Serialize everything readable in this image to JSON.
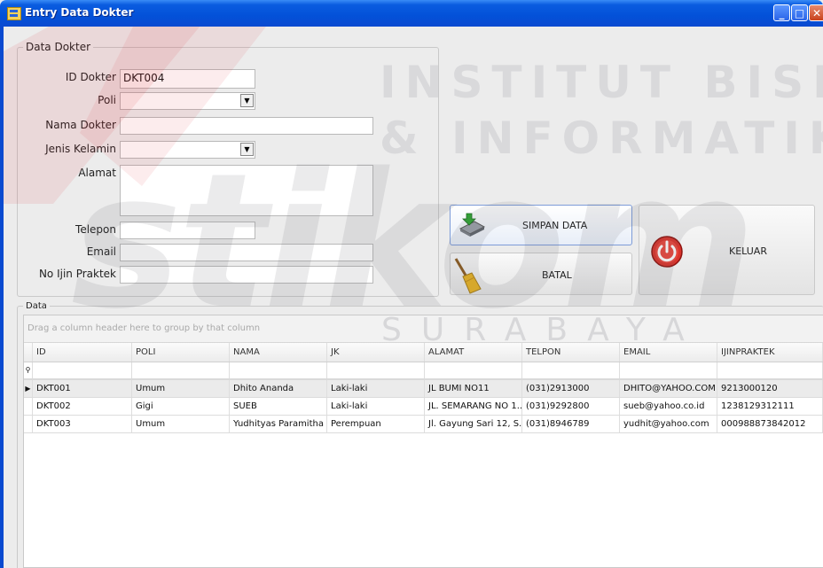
{
  "window": {
    "title": "Entry Data Dokter"
  },
  "form": {
    "group_title": "Data Dokter",
    "fields": {
      "id_dokter": {
        "label": "ID Dokter",
        "value": "DKT004"
      },
      "poli": {
        "label": "Poli",
        "value": ""
      },
      "nama_dokter": {
        "label": "Nama Dokter",
        "value": ""
      },
      "jenis_kelamin": {
        "label": "Jenis Kelamin",
        "value": ""
      },
      "alamat": {
        "label": "Alamat",
        "value": ""
      },
      "telepon": {
        "label": "Telepon",
        "value": ""
      },
      "email": {
        "label": "Email",
        "value": ""
      },
      "no_ijin_praktek": {
        "label": "No Ijin Praktek",
        "value": ""
      }
    }
  },
  "buttons": {
    "simpan": "SIMPAN DATA",
    "batal": "BATAL",
    "keluar": "KELUAR"
  },
  "grid": {
    "group_title": "Data",
    "group_hint": "Drag a column header here to group by that column",
    "columns": [
      "ID",
      "POLI",
      "NAMA",
      "JK",
      "ALAMAT",
      "TELPON",
      "EMAIL",
      "IJINPRAKTEK"
    ],
    "rows": [
      [
        "DKT001",
        "Umum",
        "Dhito Ananda",
        "Laki-laki",
        "JL BUMI NO11",
        "(031)2913000",
        "DHITO@YAHOO.COM",
        "9213000120"
      ],
      [
        "DKT002",
        "Gigi",
        "SUEB",
        "Laki-laki",
        "JL. SEMARANG NO 1...",
        "(031)9292800",
        "sueb@yahoo.co.id",
        "1238129312111"
      ],
      [
        "DKT003",
        "Umum",
        "Yudhityas Paramitha",
        "Perempuan",
        "Jl. Gayung Sari 12, S...",
        "(031)8946789",
        "yudhit@yahoo.com",
        "000988873842012"
      ]
    ]
  },
  "watermark": {
    "line1": "INSTITUT BISNIS",
    "line2": "& INFORMATIKA",
    "logo": "stikom",
    "city": "SURABAYA"
  }
}
